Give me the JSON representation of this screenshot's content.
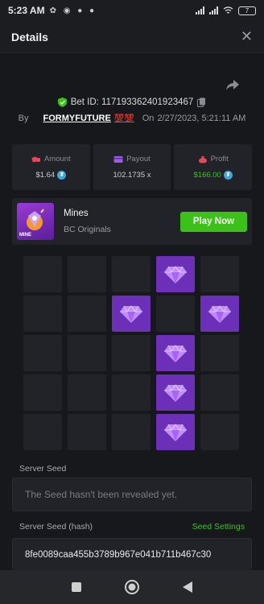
{
  "status_bar": {
    "time": "5:23 AM",
    "battery": "7"
  },
  "header": {
    "title": "Details"
  },
  "bet": {
    "id_label": "Bet ID: 117193362401923467",
    "by_label": "By",
    "username": "FORMYFUTURE",
    "hundred_emoji": "💯💯",
    "on_label": "On",
    "datetime": "2/27/2023, 5:21:11 AM"
  },
  "stats": {
    "amount": {
      "label": "Amount",
      "value": "$1.64"
    },
    "payout": {
      "label": "Payout",
      "value": "102.1735 x"
    },
    "profit": {
      "label": "Profit",
      "value": "$166.00"
    }
  },
  "game": {
    "thumb_label": "MINE",
    "name": "Mines",
    "provider": "BC Originals",
    "play_label": "Play Now"
  },
  "mines_grid": [
    [
      0,
      0,
      0,
      1,
      0
    ],
    [
      0,
      0,
      1,
      0,
      1
    ],
    [
      0,
      0,
      0,
      1,
      0
    ],
    [
      0,
      0,
      0,
      1,
      0
    ],
    [
      0,
      0,
      0,
      1,
      0
    ]
  ],
  "seeds": {
    "server_seed_label": "Server Seed",
    "server_seed_value": "The Seed hasn't been revealed yet.",
    "server_seed_hash_label": "Server Seed (hash)",
    "seed_settings_label": "Seed Settings",
    "server_seed_hash_value": "8fe0089caa455b3789b967e041b711b467c30"
  },
  "colors": {
    "accent_green": "#3bc117",
    "gem_tile": "#6b2fb8",
    "tile": "#222328",
    "background": "#17181b"
  },
  "icons": [
    "shield-check-icon",
    "copy-icon",
    "share-icon",
    "close-icon",
    "coin-icon",
    "gem-icon"
  ]
}
